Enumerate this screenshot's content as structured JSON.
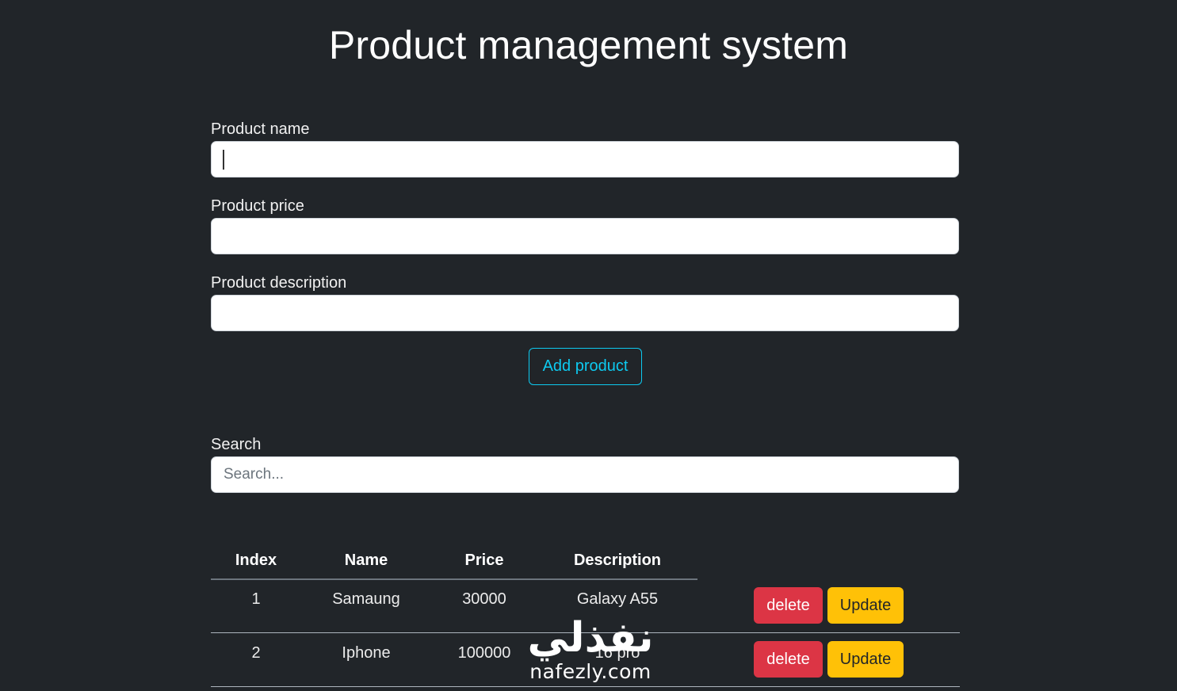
{
  "page": {
    "title": "Product management system"
  },
  "form": {
    "name_label": "Product name",
    "name_value": "",
    "price_label": "Product price",
    "price_value": "",
    "description_label": "Product description",
    "description_value": "",
    "add_button": "Add product"
  },
  "search": {
    "label": "Search",
    "placeholder": "Search..."
  },
  "table": {
    "headers": {
      "index": "Index",
      "name": "Name",
      "price": "Price",
      "description": "Description"
    },
    "rows": [
      {
        "index": "1",
        "name": "Samaung",
        "price": "30000",
        "description": "Galaxy A55",
        "delete": "delete",
        "update": "Update"
      },
      {
        "index": "2",
        "name": "Iphone",
        "price": "100000",
        "description": "16 pro",
        "delete": "delete",
        "update": "Update"
      }
    ]
  },
  "watermark": {
    "logo_text": "نفذلي",
    "domain": "nafezly.com"
  },
  "colors": {
    "background": "#212529",
    "add_button_accent": "#0dcaf0",
    "delete_button": "#dc3545",
    "update_button": "#ffc107"
  }
}
